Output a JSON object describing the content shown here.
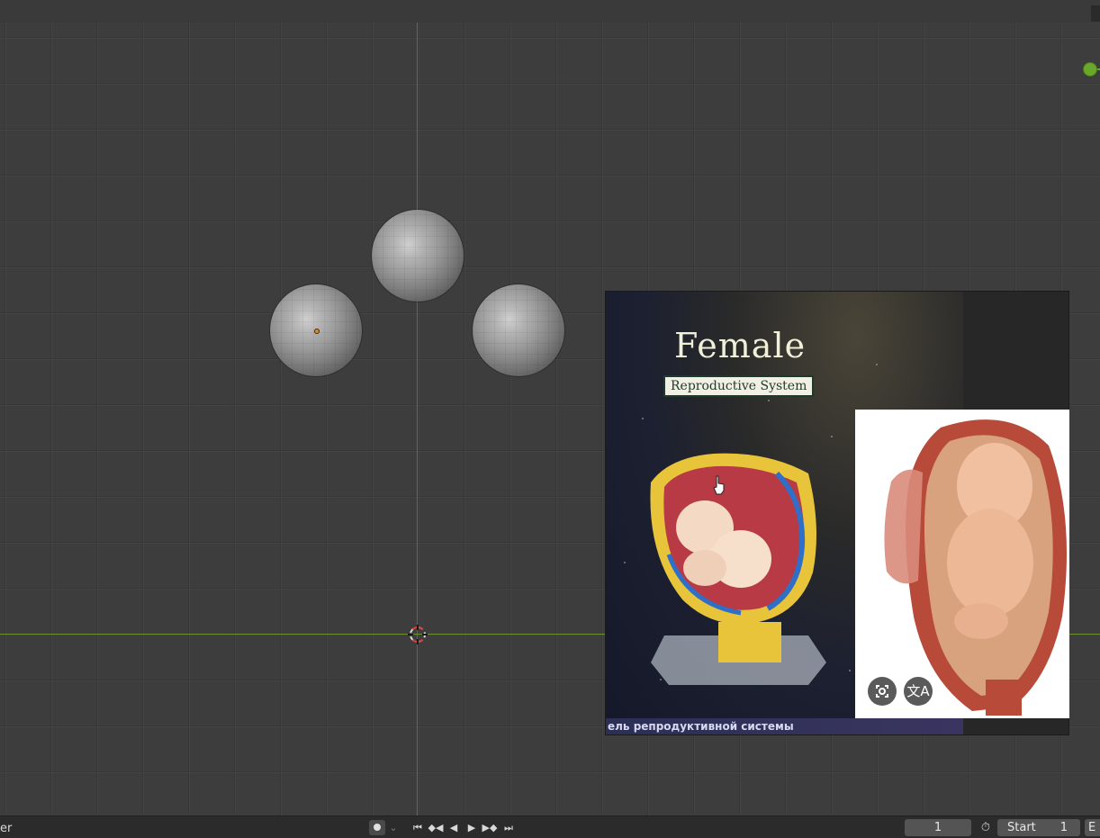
{
  "viewport": {
    "axis_colors": {
      "x": "#6b8f2f",
      "y": "#3d6ea4"
    },
    "objects": [
      "uv-sphere",
      "uv-sphere",
      "uv-sphere"
    ]
  },
  "overlay": {
    "photo": {
      "title": "Female",
      "subtitle": "Reproductive System",
      "bottom_text": "ель репродуктивной системы"
    },
    "buttons": {
      "lens_icon": "google-lens-icon",
      "translate_icon": "translate-icon",
      "translate_glyph": "文A"
    }
  },
  "status_bar": {
    "left_text": "er",
    "playback_icons": [
      "jump-start-icon",
      "prev-keyframe-icon",
      "play-reverse-icon",
      "play-icon",
      "next-keyframe-icon",
      "jump-end-icon"
    ],
    "current_frame": "1",
    "start_label": "Start",
    "start_value": "1",
    "end_label": "E"
  }
}
